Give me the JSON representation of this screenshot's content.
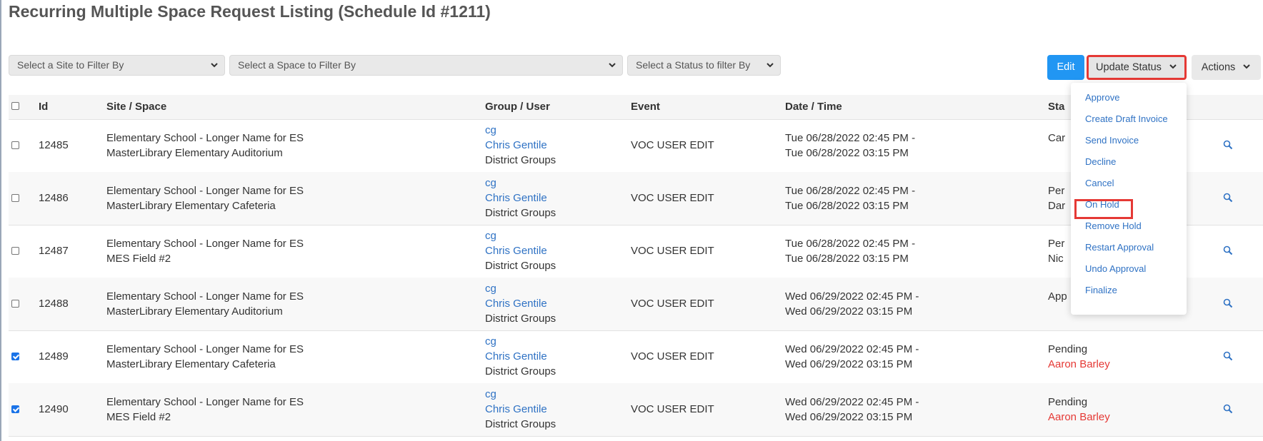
{
  "page": {
    "title": "Recurring Multiple Space Request Listing (Schedule Id #1211)"
  },
  "filters": {
    "site": "Select a Site to Filter By",
    "space": "Select a Space to Filter By",
    "status": "Select a Status to filter By"
  },
  "toolbar": {
    "edit": "Edit",
    "update_status": "Update Status",
    "actions": "Actions"
  },
  "table": {
    "headers": {
      "id": "Id",
      "site_space": "Site / Space",
      "group_user": "Group / User",
      "event": "Event",
      "datetime": "Date / Time",
      "status": "Sta"
    },
    "rows": [
      {
        "checked": false,
        "id": "12485",
        "site": "Elementary School - Longer Name for ES",
        "space": "MasterLibrary Elementary Auditorium",
        "group": "cg",
        "user": "Chris Gentile",
        "groups": "District Groups",
        "event": "VOC USER EDIT",
        "start": "Tue 06/28/2022 02:45 PM -",
        "end": "Tue 06/28/2022 03:15 PM",
        "status": "Car",
        "status_user": ""
      },
      {
        "checked": false,
        "id": "12486",
        "site": "Elementary School - Longer Name for ES",
        "space": "MasterLibrary Elementary Cafeteria",
        "group": "cg",
        "user": "Chris Gentile",
        "groups": "District Groups",
        "event": "VOC USER EDIT",
        "start": "Tue 06/28/2022 02:45 PM -",
        "end": "Tue 06/28/2022 03:15 PM",
        "status": "Per",
        "status_user": "Dar"
      },
      {
        "checked": false,
        "id": "12487",
        "site": "Elementary School - Longer Name for ES",
        "space": "MES Field #2",
        "group": "cg",
        "user": "Chris Gentile",
        "groups": "District Groups",
        "event": "VOC USER EDIT",
        "start": "Tue 06/28/2022 02:45 PM -",
        "end": "Tue 06/28/2022 03:15 PM",
        "status": "Per",
        "status_user": "Nic"
      },
      {
        "checked": false,
        "id": "12488",
        "site": "Elementary School - Longer Name for ES",
        "space": "MasterLibrary Elementary Auditorium",
        "group": "cg",
        "user": "Chris Gentile",
        "groups": "District Groups",
        "event": "VOC USER EDIT",
        "start": "Wed 06/29/2022 02:45 PM -",
        "end": "Wed 06/29/2022 03:15 PM",
        "status": "App",
        "status_user": ""
      },
      {
        "checked": true,
        "id": "12489",
        "site": "Elementary School - Longer Name for ES",
        "space": "MasterLibrary Elementary Cafeteria",
        "group": "cg",
        "user": "Chris Gentile",
        "groups": "District Groups",
        "event": "VOC USER EDIT",
        "start": "Wed 06/29/2022 02:45 PM -",
        "end": "Wed 06/29/2022 03:15 PM",
        "status": "Pending",
        "status_user": "Aaron Barley"
      },
      {
        "checked": true,
        "id": "12490",
        "site": "Elementary School - Longer Name for ES",
        "space": "MES Field #2",
        "group": "cg",
        "user": "Chris Gentile",
        "groups": "District Groups",
        "event": "VOC USER EDIT",
        "start": "Wed 06/29/2022 02:45 PM -",
        "end": "Wed 06/29/2022 03:15 PM",
        "status": "Pending",
        "status_user": "Aaron Barley"
      }
    ]
  },
  "status_menu": {
    "items": [
      "Approve",
      "Create Draft Invoice",
      "Send Invoice",
      "Decline",
      "Cancel",
      "On Hold",
      "Remove Hold",
      "Restart Approval",
      "Undo Approval",
      "Finalize"
    ]
  },
  "colors": {
    "primary": "#2196f3",
    "link": "#2f72c4",
    "highlight": "#e53935"
  }
}
